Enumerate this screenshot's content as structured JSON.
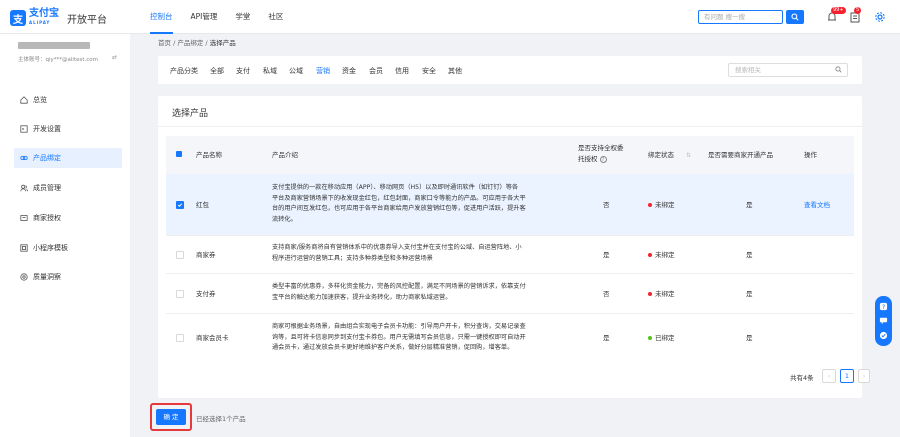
{
  "header": {
    "logo_mark": "支",
    "logo_cn": "支付宝",
    "logo_en": "ALIPAY",
    "platform_title": "开放平台",
    "nav": [
      "控制台",
      "API管理",
      "学堂",
      "社区"
    ],
    "search_placeholder": "有问题 搜一搜",
    "message_badge": "99+",
    "notice_badge": "5"
  },
  "sidebar": {
    "account_id": "主体账号：qiy***@alitest.com",
    "menu": [
      "总览",
      "开发设置",
      "产品绑定",
      "成员管理",
      "商家授权",
      "小程序模板",
      "质量洞察"
    ]
  },
  "breadcrumb": {
    "items": [
      "首页",
      "产品绑定"
    ],
    "current": "选择产品"
  },
  "filter": {
    "categories": [
      "产品分类",
      "全部",
      "支付",
      "私域",
      "公域",
      "营销",
      "资金",
      "会员",
      "信用",
      "安全",
      "其他"
    ],
    "active": "营销",
    "search_placeholder": "搜索相关"
  },
  "table": {
    "title": "选择产品",
    "headers": {
      "name": "产品名称",
      "intro": "产品介绍",
      "auth1": "是否支持全权委",
      "auth2": "托授权",
      "status": "绑定状态",
      "merchant": "是否需要商家开通产品",
      "action": "操作"
    },
    "rows": [
      {
        "name": "红包",
        "desc": [
          "支付宝提供的一款在移动应用（APP）、移动网页（H5）以及即时通讯软件（如钉钉）等各",
          "平台及商家营销场景下的收发现金红包，红包封面，商家口令等能力的产品。可应用于各大平",
          "台的用户间互发红包，也可应用于各平台商家给用户发放营销红包等，促进用户活跃，提升客",
          "流转化。"
        ],
        "auth": "否",
        "status": "未绑定",
        "merchant": "是",
        "action": "查看文档",
        "selected": true
      },
      {
        "name": "商家券",
        "desc": [
          "支持商家/服务商将自有营销体系中的优惠券导入支付宝并在支付宝的公域、自运营阵地、小",
          "程序进行运营的营销工具；支持多种券类型和多种运营场景"
        ],
        "auth": "是",
        "status": "未绑定",
        "merchant": "是",
        "action": "",
        "selected": false
      },
      {
        "name": "支付券",
        "desc": [
          "类型丰富的优惠券，多样化资金能力，完备的风控配置，满足不同场景的营销诉求，依靠支付",
          "宝平台的触达能力加速获客，提升业务转化，助力商家私域运营。"
        ],
        "auth": "否",
        "status": "未绑定",
        "merchant": "是",
        "action": "",
        "selected": false
      },
      {
        "name": "商家会员卡",
        "desc": [
          "商家可根据业务场景，自由组合实现电子会员卡功能：引导用户开卡，积分查询，交易记录查",
          "询等，且可将卡信息同步到支付宝卡券包。用户无需填写会员信息，只需一键授权即可自动开",
          "通会员卡，通过发放会员卡更好地维护客户关系，做好分层精准营销，促回购，增客单。"
        ],
        "auth": "是",
        "status": "已绑定",
        "merchant": "是",
        "action": "",
        "selected": false
      }
    ],
    "total": "共有4条",
    "page": "1"
  },
  "footer": {
    "confirm_label": "确 定",
    "selected_text": "已经选择1个产品"
  },
  "colors": {
    "primary": "#1677ff",
    "unbound": "#f5222d",
    "bound": "#52c41a",
    "highlight": "#e5393b"
  }
}
